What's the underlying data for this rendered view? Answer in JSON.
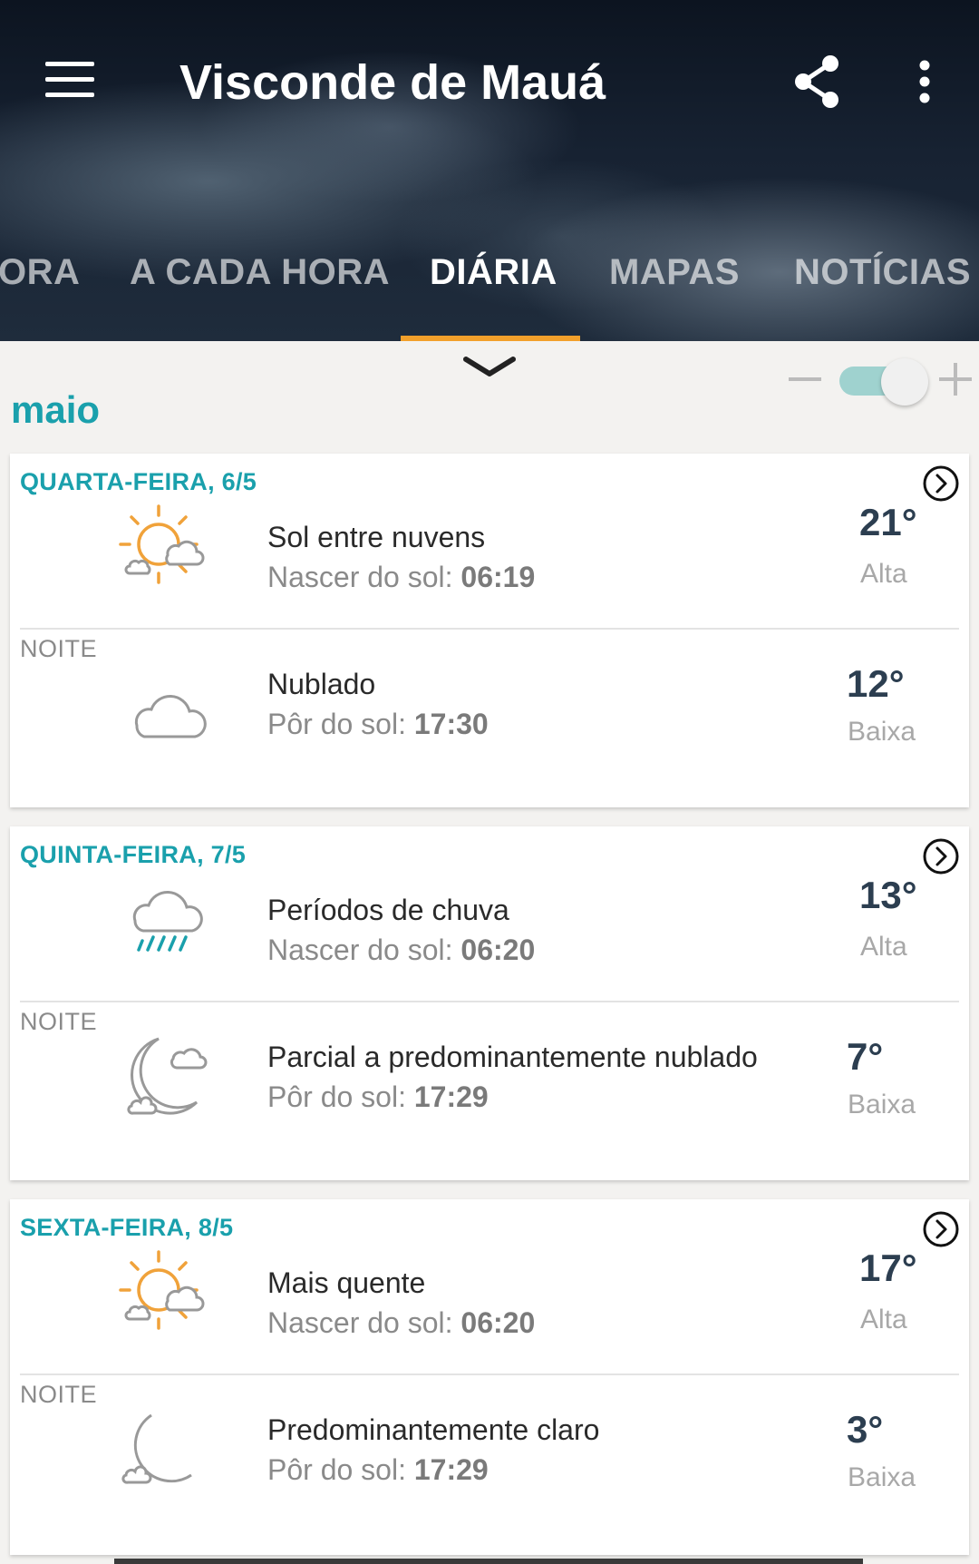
{
  "header": {
    "title": "Visconde de Mauá",
    "tabs": [
      "ORA",
      "A CADA HORA",
      "DIÁRIA",
      "MAPAS",
      "NOTÍCIAS"
    ],
    "active_tab": "DIÁRIA"
  },
  "colors": {
    "accent": "#1aa0ac",
    "tab_underline": "#f2a02b",
    "toggle_track": "#9fd2cf"
  },
  "month": "maio",
  "days": [
    {
      "date": "QUARTA-FEIRA, 6/5",
      "day": {
        "icon": "partly-sunny-icon",
        "condition": "Sol entre nuvens",
        "sun_label": "Nascer do sol:",
        "sun_time": "06:19",
        "temp": "21°",
        "temp_label": "Alta"
      },
      "night": {
        "label": "NOITE",
        "icon": "cloud-icon",
        "condition": "Nublado",
        "sun_label": "Pôr do sol:",
        "sun_time": "17:30",
        "temp": "12°",
        "temp_label": "Baixa"
      }
    },
    {
      "date": "QUINTA-FEIRA, 7/5",
      "day": {
        "icon": "rain-icon",
        "condition": "Períodos de chuva",
        "sun_label": "Nascer do sol:",
        "sun_time": "06:20",
        "temp": "13°",
        "temp_label": "Alta"
      },
      "night": {
        "label": "NOITE",
        "icon": "moon-cloud-icon",
        "condition": "Parcial a predominantemente nublado",
        "sun_label": "Pôr do sol:",
        "sun_time": "17:29",
        "temp": "7°",
        "temp_label": "Baixa"
      }
    },
    {
      "date": "SEXTA-FEIRA, 8/5",
      "day": {
        "icon": "partly-sunny-icon",
        "condition": "Mais quente",
        "sun_label": "Nascer do sol:",
        "sun_time": "06:20",
        "temp": "17°",
        "temp_label": "Alta"
      },
      "night": {
        "label": "NOITE",
        "icon": "moon-small-cloud-icon",
        "condition": "Predominantemente claro",
        "sun_label": "Pôr do sol:",
        "sun_time": "17:29",
        "temp": "3°",
        "temp_label": "Baixa"
      }
    }
  ]
}
